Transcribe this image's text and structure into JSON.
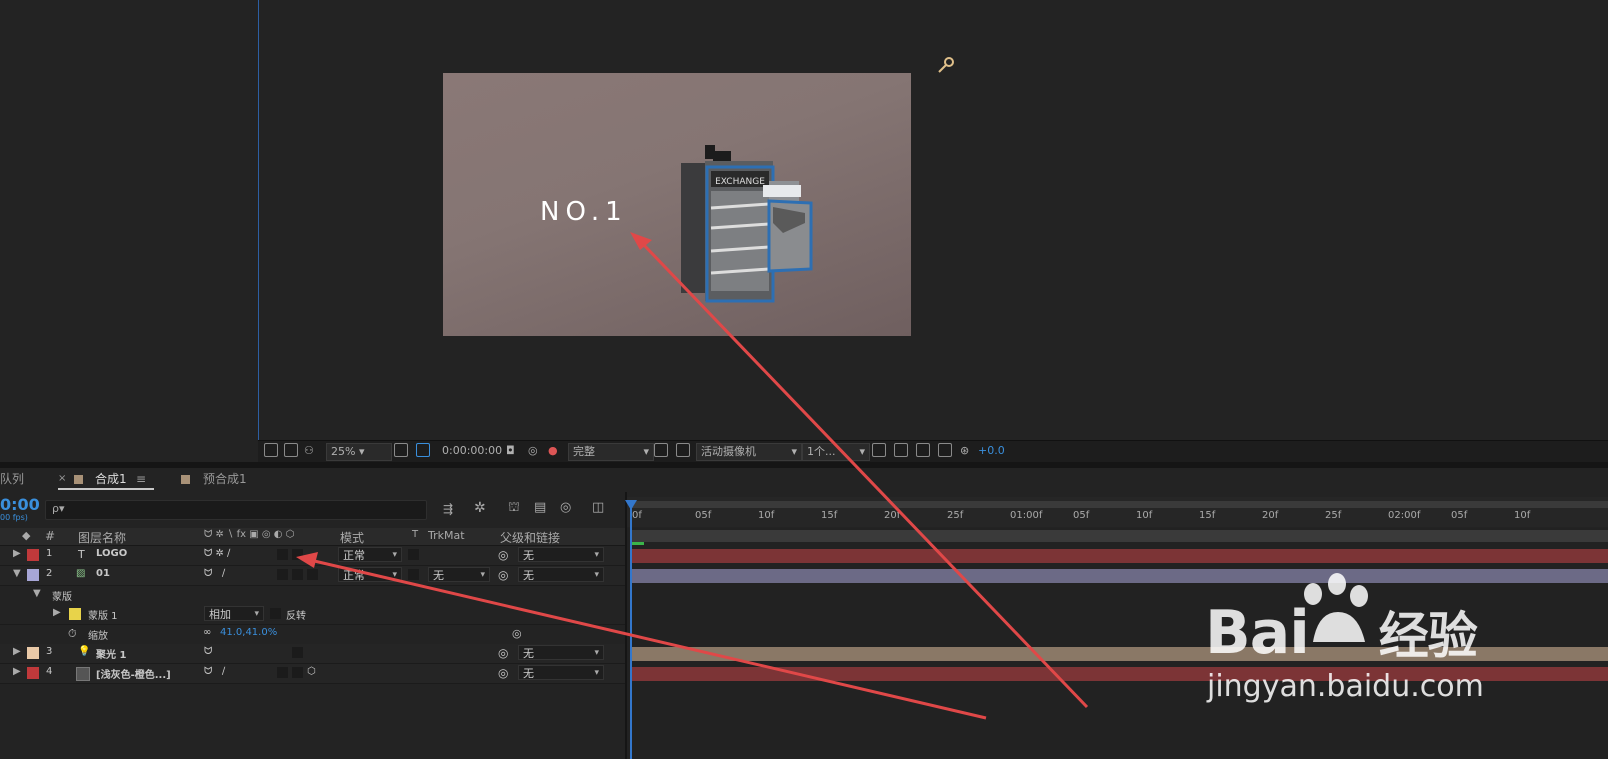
{
  "viewer": {
    "composition_text": "NO.1",
    "cabinet_label": "EXCHANGE",
    "zoom": "25%",
    "timecode": "0:00:00:00",
    "resolution": "完整",
    "camera": "活动摄像机",
    "views": "1个...",
    "exposure": "+0.0"
  },
  "tabs": {
    "left_partial": "队列",
    "close": "×",
    "comp1": "合成1",
    "menu": "≡",
    "precomp1": "预合成1"
  },
  "timeline": {
    "timecode": "0:00",
    "fps": "00 fps)",
    "search_placeholder": "ρ▾"
  },
  "columns": {
    "hash": "#",
    "layer_name": "图层名称",
    "mode": "模式",
    "t": "T",
    "trkmat": "TrkMat",
    "parent": "父级和链接"
  },
  "layers": [
    {
      "num": "1",
      "type_icon": "T",
      "name": "LOGO",
      "color": "#c0393b",
      "mode": "正常",
      "parent": "无",
      "bar_color": "#7c3436"
    },
    {
      "num": "2",
      "type_icon": "footage",
      "name": "01",
      "color": "#a7a6d6",
      "mode": "正常",
      "trkmat": "无",
      "parent": "无",
      "bar_color": "#6c6a86"
    },
    {
      "num": "3",
      "type_icon": "light",
      "name": "聚光 1",
      "color": "#e9c9a7",
      "parent": "无",
      "bar_color": "#8a7866"
    },
    {
      "num": "4",
      "type_icon": "solid",
      "name": "[浅灰色-橙色...]",
      "color": "#c0393b",
      "parent": "无",
      "bar_color": "#7c3436"
    }
  ],
  "mask_group": {
    "group_label": "蒙版",
    "mask_name": "蒙版 1",
    "mask_mode": "相加",
    "invert_label": "反转",
    "scale_label": "缩放",
    "scale_value": "41.0,41.0%"
  },
  "ruler_ticks": [
    "0f",
    "05f",
    "10f",
    "15f",
    "20f",
    "25f",
    "01:00f",
    "05f",
    "10f",
    "15f",
    "20f",
    "25f",
    "02:00f",
    "05f",
    "10f"
  ],
  "watermark": {
    "text": "Bai",
    "text2": "经验",
    "url": "jingyan.baidu.com"
  },
  "colors": {
    "accent_blue": "#3a8fdc",
    "arrow_red": "#e04848"
  }
}
